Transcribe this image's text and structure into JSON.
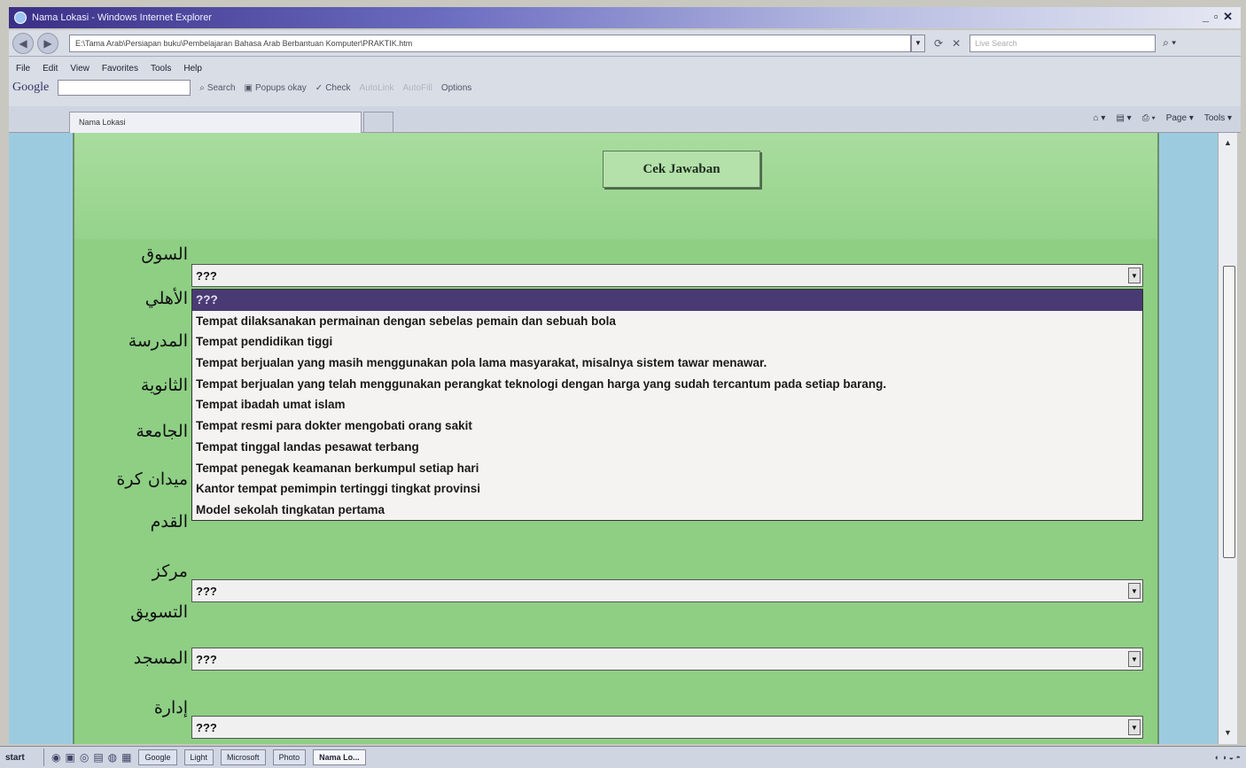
{
  "window": {
    "title": "Nama Lokasi - Windows Internet Explorer",
    "controls": "_ ▫ ✕"
  },
  "address_bar": {
    "url": "E:\\Tama Arab\\Persiapan buku\\Pembelajaran Bahasa Arab Berbantuan Komputer\\PRAKTIK.htm",
    "search_placeholder": "Live Search"
  },
  "menu": [
    "File",
    "Edit",
    "View",
    "Favorites",
    "Tools",
    "Help"
  ],
  "google_toolbar": {
    "logo": "Google",
    "items": [
      "Search",
      "Popups okay",
      "Check",
      "AutoLink",
      "AutoFill",
      "Options"
    ]
  },
  "tab": {
    "label": "Nama Lokasi"
  },
  "command_bar": [
    "Page ▾",
    "Tools ▾"
  ],
  "quiz": {
    "check_button": "Cek Jawaban",
    "labels": [
      "السوق",
      "الأهلي",
      "المدرسة",
      "الثانوية",
      "الجامعة",
      "ميدان كرة",
      "القدم",
      "مركز",
      "التسويق",
      "المسجد",
      "إدارة"
    ],
    "select_value": "???",
    "options": [
      "???",
      "Tempat dilaksanakan permainan dengan sebelas pemain dan sebuah bola",
      "Tempat pendidikan tiggi",
      "Tempat berjualan yang masih menggunakan pola lama masyarakat, misalnya sistem tawar menawar.",
      "Tempat berjualan yang telah menggunakan perangkat teknologi dengan harga yang sudah tercantum pada setiap barang.",
      "Tempat ibadah umat islam",
      "Tempat resmi para dokter mengobati orang sakit",
      "Tempat tinggal landas pesawat terbang",
      "Tempat penegak keamanan berkumpul setiap hari",
      "Kantor tempat pemimpin tertinggi tingkat provinsi",
      "Model sekolah tingkatan pertama"
    ]
  },
  "taskbar": {
    "start": "start",
    "tasks": [
      "Google",
      "Light",
      "Microsoft",
      "Photo",
      "Nama Lo..."
    ]
  },
  "colors": {
    "panel_green": "#8ecf84",
    "side_blue": "#9ccbe0",
    "selected_option": "#4a3a74"
  }
}
